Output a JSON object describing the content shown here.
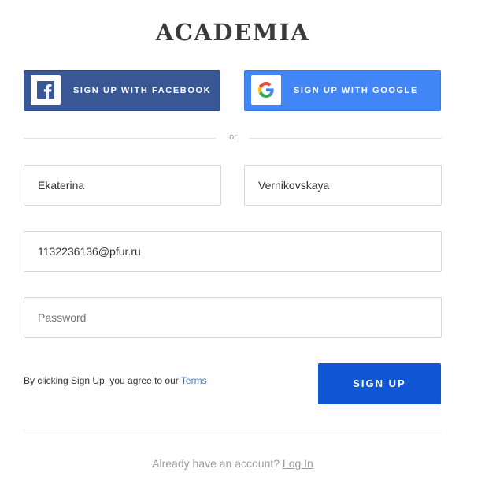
{
  "brand": {
    "logo_text": "ACADEMIA"
  },
  "social": {
    "facebook_label": "SIGN UP WITH FACEBOOK",
    "facebook_color": "#3a5795",
    "google_label": "SIGN UP WITH GOOGLE",
    "google_color": "#4286f5",
    "facebook_icon": "facebook-icon",
    "google_icon": "google-icon"
  },
  "divider": {
    "text": "or"
  },
  "form": {
    "first_name_value": "Ekaterina",
    "last_name_value": "Vernikovskaya",
    "email_value": "1132236136@pfur.ru",
    "password_placeholder": "Password",
    "terms_prefix": "By clicking Sign Up, you agree to our",
    "terms_link": "Terms",
    "submit_label": "SIGN UP",
    "submit_color": "#1057d5"
  },
  "footer": {
    "login_prompt": "Already have an account?",
    "login_link": "Log In"
  }
}
